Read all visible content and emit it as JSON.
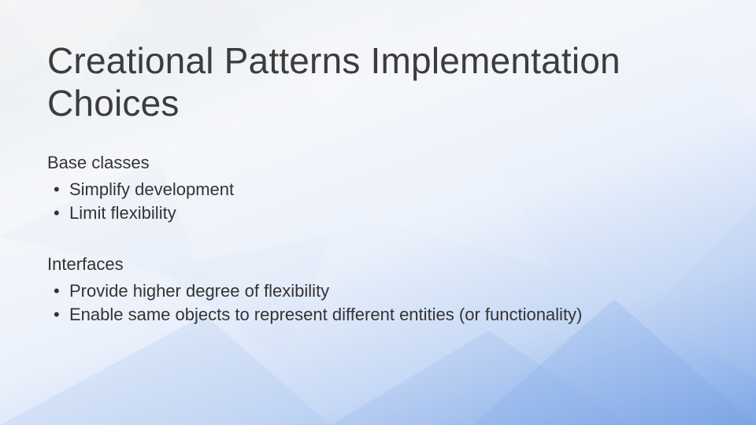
{
  "slide": {
    "title": "Creational Patterns Implementation Choices",
    "sections": [
      {
        "heading": "Base classes",
        "bullets": [
          "Simplify development",
          "Limit flexibility"
        ]
      },
      {
        "heading": "Interfaces",
        "bullets": [
          "Provide higher degree of flexibility",
          "Enable same objects to represent different entities (or functionality)"
        ]
      }
    ]
  }
}
